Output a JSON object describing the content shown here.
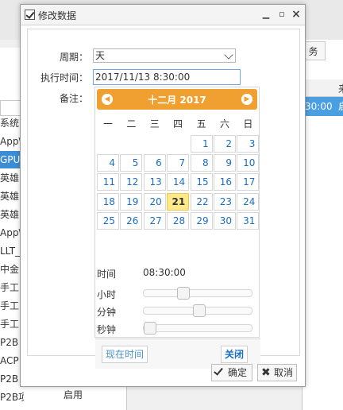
{
  "background": {
    "list_items": [
      "系统",
      "App\\",
      "GPU",
      "英雄",
      "英雄",
      "英雄",
      "App\\",
      "LLT_",
      "中金",
      "手工",
      "手工",
      "手工",
      "P2B",
      "ACP",
      "P2B",
      "P2B项目"
    ],
    "selected_index": 2,
    "tab_label": "务",
    "column_header_fragment": "来",
    "selected_row_time": "30:00",
    "selected_row_fragment": "启",
    "bottom_text": "启用"
  },
  "dialog": {
    "title": "修改数据",
    "labels": {
      "period": "周期：",
      "exec_time": "执行时间：",
      "note": "备注："
    },
    "period_value": "天",
    "exec_time_value": "2017/11/13 8:30:00",
    "buttons": {
      "ok": "确定",
      "cancel": "取消"
    }
  },
  "datepicker": {
    "month_title": "十二月 2017",
    "weekdays": [
      "一",
      "二",
      "三",
      "四",
      "五",
      "六",
      "日"
    ],
    "days": [
      [
        "",
        "",
        "",
        "",
        "1",
        "2",
        "3"
      ],
      [
        "4",
        "5",
        "6",
        "7",
        "8",
        "9",
        "10"
      ],
      [
        "11",
        "12",
        "13",
        "14",
        "15",
        "16",
        "17"
      ],
      [
        "18",
        "19",
        "20",
        "21",
        "22",
        "23",
        "24"
      ],
      [
        "25",
        "26",
        "27",
        "28",
        "29",
        "30",
        "31"
      ]
    ],
    "today": "21",
    "time_label": "时间",
    "time_value": "08:30:00",
    "hour_label": "小时",
    "minute_label": "分钟",
    "second_label": "秒钟",
    "hour": 8,
    "minute": 30,
    "second": 0,
    "now_button": "现在时间",
    "close_button": "关闭"
  }
}
